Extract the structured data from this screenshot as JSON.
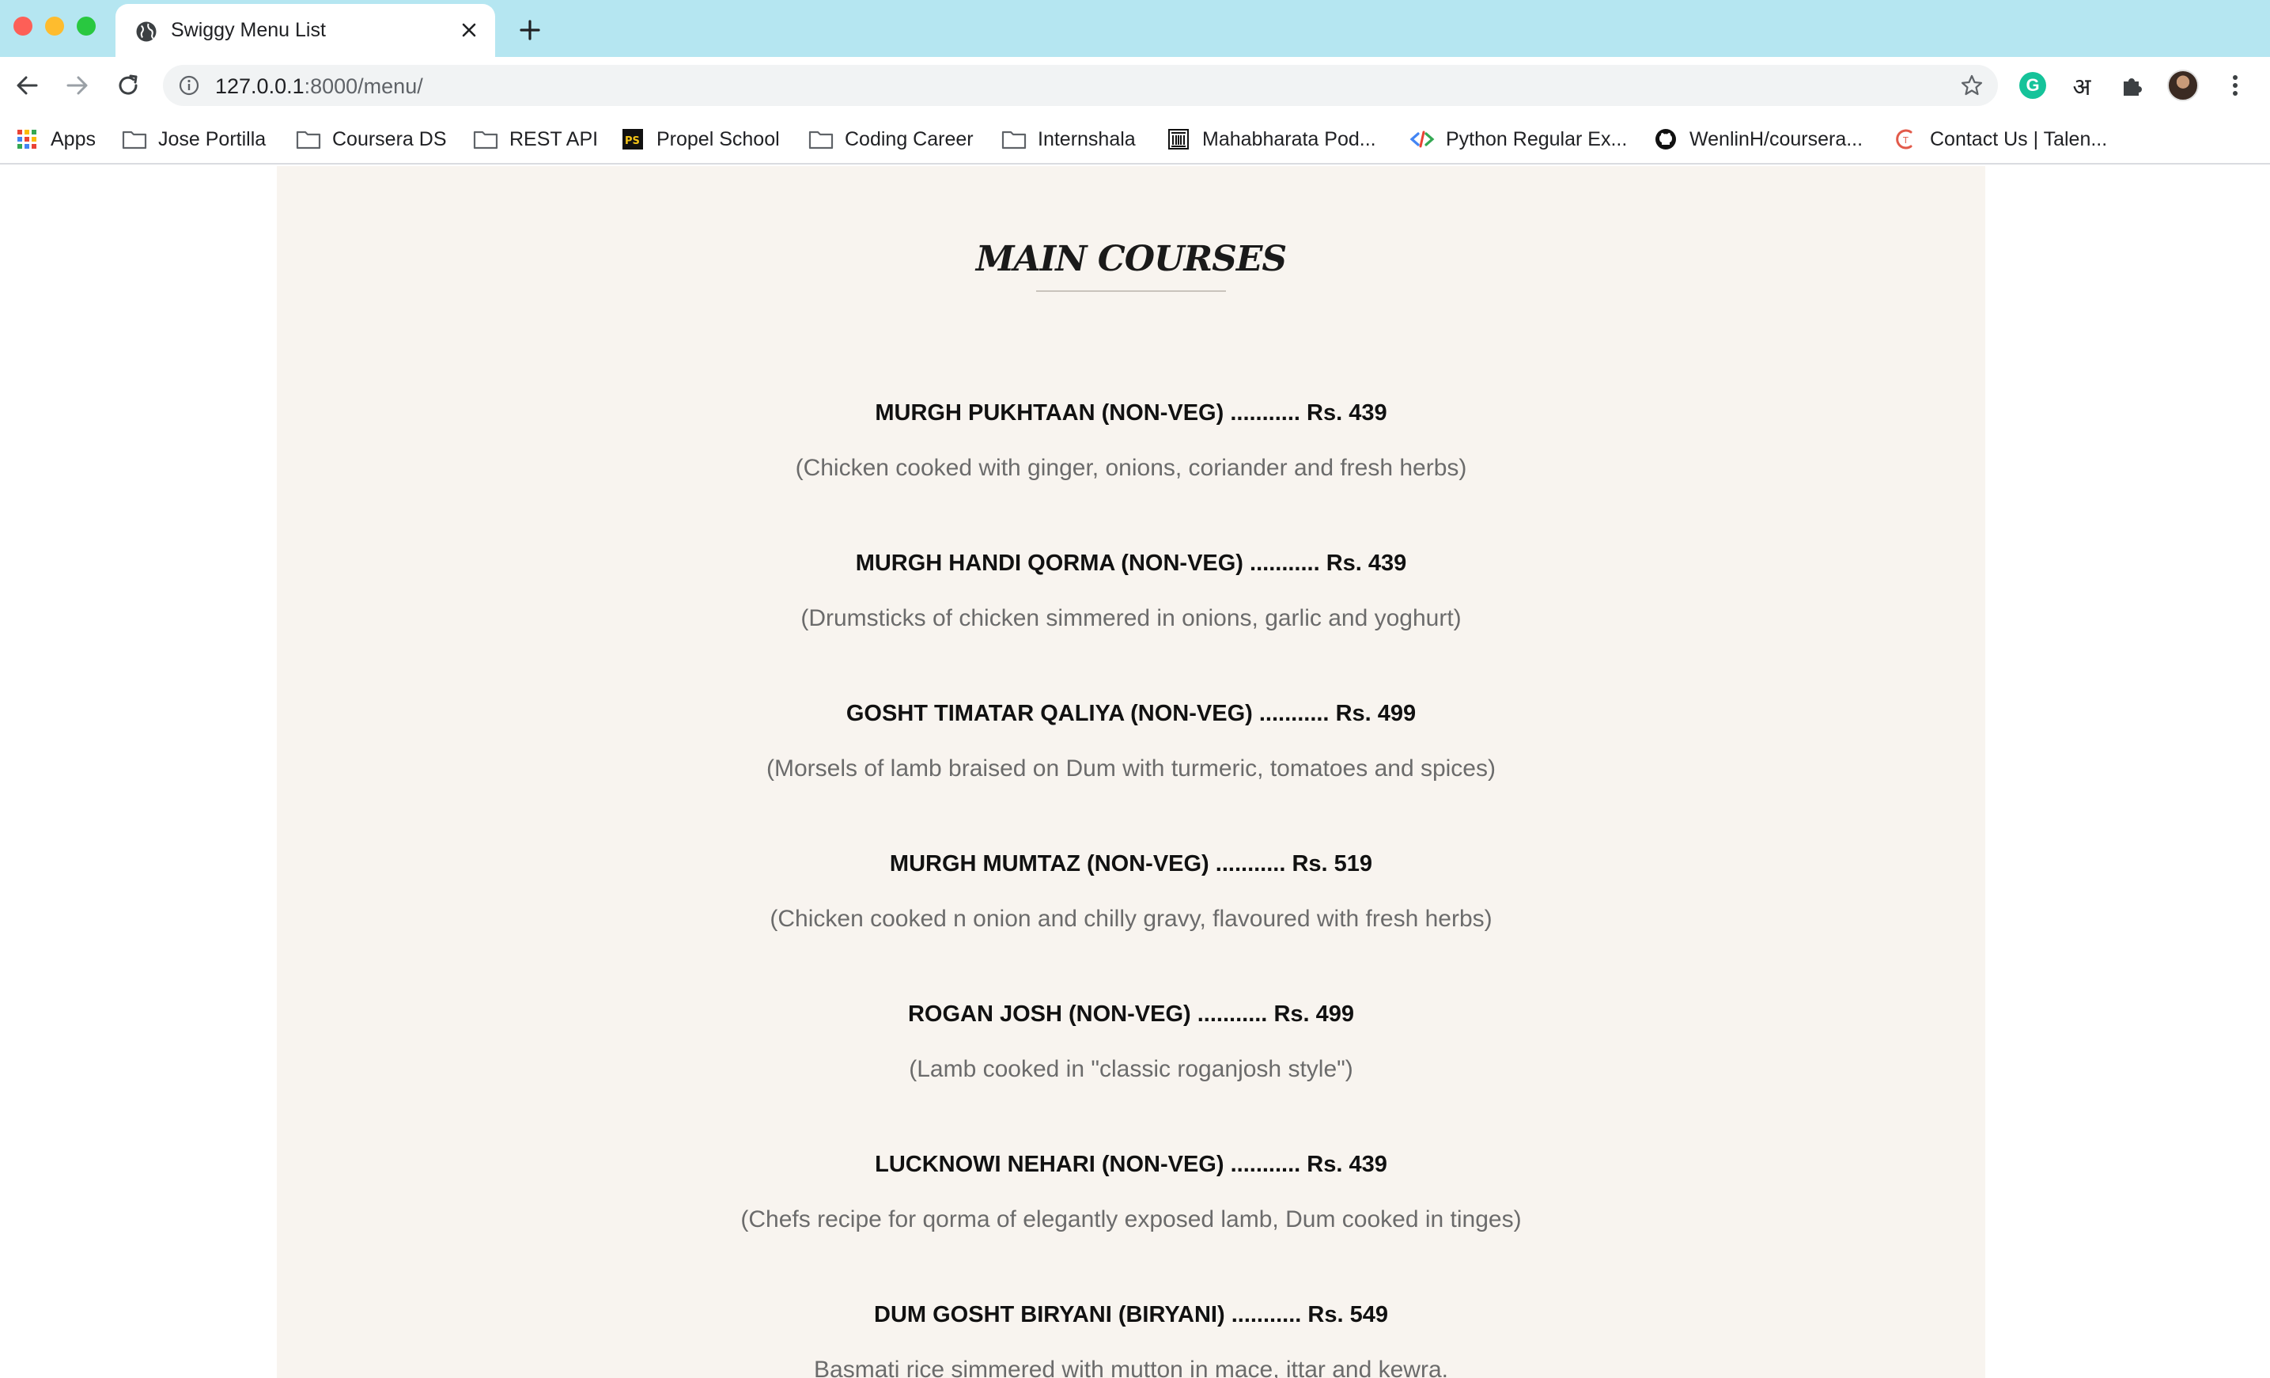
{
  "browser": {
    "tab": {
      "title": "Swiggy Menu List",
      "icon": "globe-icon"
    },
    "address_bar": {
      "host": "127.0.0.1",
      "rest": ":8000/menu/"
    },
    "bookmarks": [
      {
        "label": "Apps",
        "icon": "apps-grid-icon"
      },
      {
        "label": "Jose Portilla",
        "icon": "folder-icon"
      },
      {
        "label": "Coursera DS",
        "icon": "folder-icon"
      },
      {
        "label": "REST API",
        "icon": "folder-icon"
      },
      {
        "label": "Propel School",
        "icon": "propel-school-icon"
      },
      {
        "label": "Coding Career",
        "icon": "folder-icon"
      },
      {
        "label": "Internshala",
        "icon": "folder-icon"
      },
      {
        "label": "Mahabharata Pod...",
        "icon": "museum-icon"
      },
      {
        "label": "Python Regular Ex...",
        "icon": "code-brackets-icon"
      },
      {
        "label": "WenlinH/coursera...",
        "icon": "github-icon"
      },
      {
        "label": "Contact Us | Talen...",
        "icon": "talentsprint-icon"
      }
    ],
    "extensions": {
      "grammarly_letter": "G",
      "hindi_letter": "अ"
    }
  },
  "menu": {
    "section_title": "MAIN COURSES",
    "separator": "...........",
    "items": [
      {
        "name": "MURGH PUKHTAAN (NON-VEG)",
        "price": "Rs. 439",
        "description": "(Chicken cooked with ginger, onions, coriander and fresh herbs)"
      },
      {
        "name": "MURGH HANDI QORMA (NON-VEG)",
        "price": "Rs. 439",
        "description": "(Drumsticks of chicken simmered in onions, garlic and yoghurt)"
      },
      {
        "name": "GOSHT TIMATAR QALIYA (NON-VEG)",
        "price": "Rs. 499",
        "description": "(Morsels of lamb braised on Dum with turmeric, tomatoes and spices)"
      },
      {
        "name": "MURGH MUMTAZ (NON-VEG)",
        "price": "Rs. 519",
        "description": "(Chicken cooked n onion and chilly gravy, flavoured with fresh herbs)"
      },
      {
        "name": "ROGAN JOSH (NON-VEG)",
        "price": "Rs. 499",
        "description": "(Lamb cooked in \"classic roganjosh style\")"
      },
      {
        "name": "LUCKNOWI NEHARI (NON-VEG)",
        "price": "Rs. 439",
        "description": "(Chefs recipe for qorma of elegantly exposed lamb, Dum cooked in tinges)"
      },
      {
        "name": "DUM GOSHT BIRYANI (BIRYANI)",
        "price": "Rs. 549",
        "description": "Basmati rice simmered with mutton in mace, ittar and kewra."
      }
    ]
  }
}
